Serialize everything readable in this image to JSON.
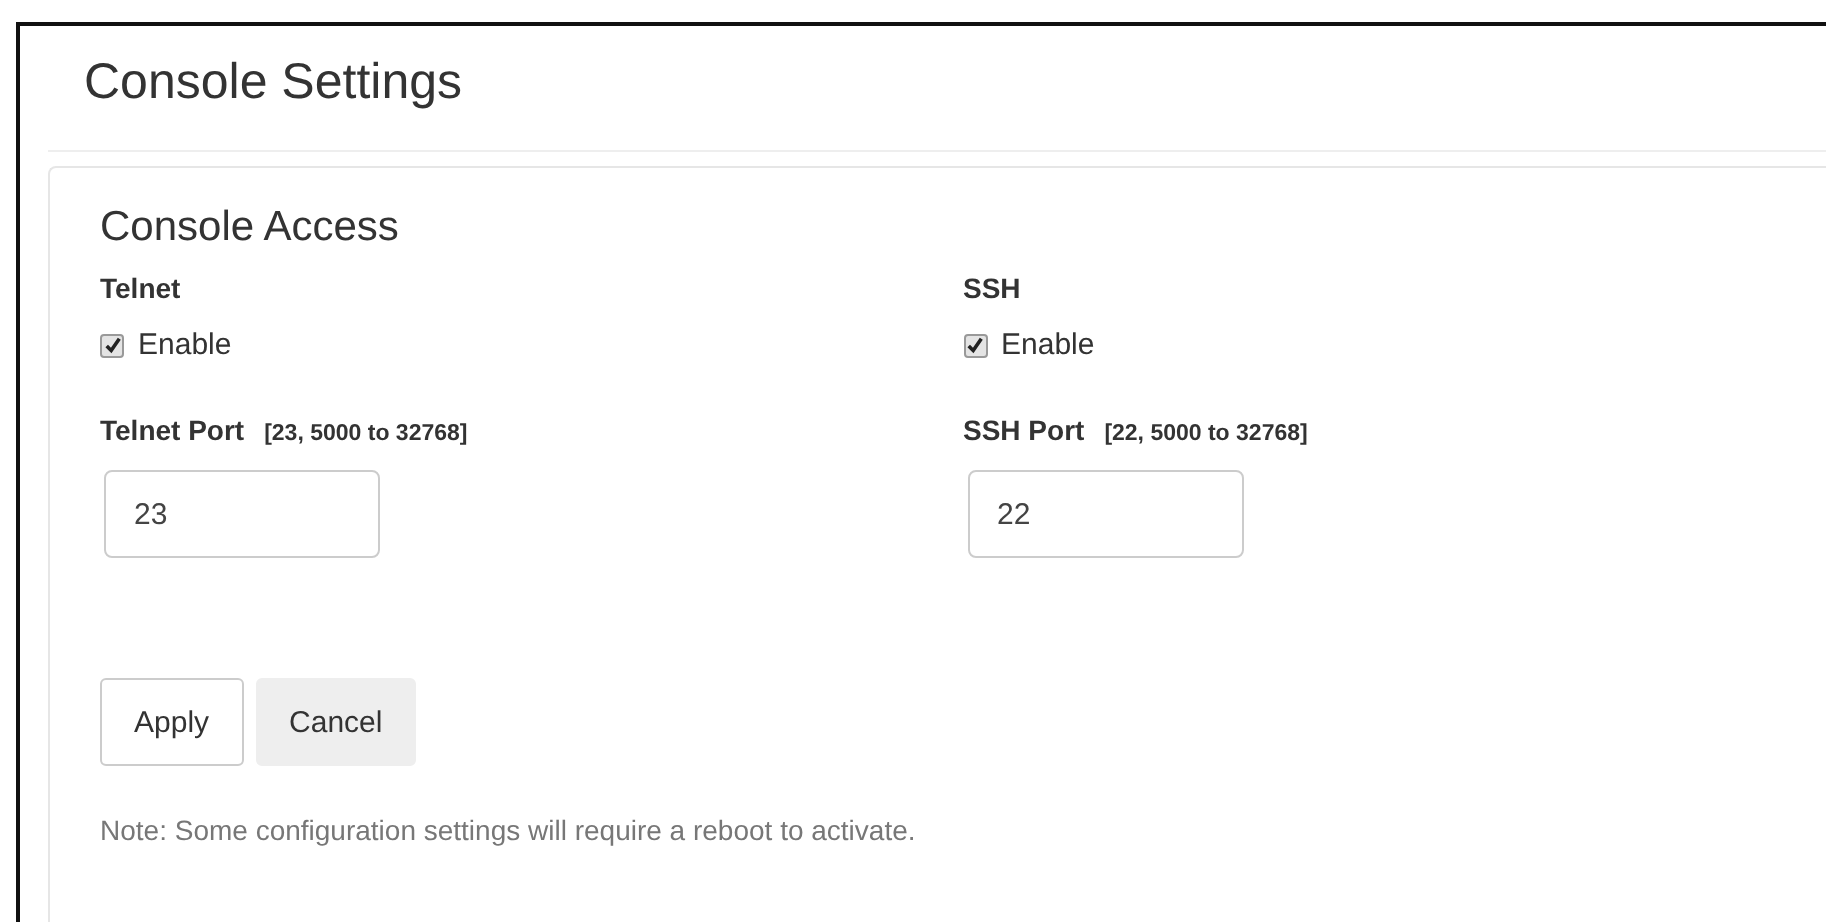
{
  "page_title": "Console Settings",
  "section": {
    "title": "Console Access",
    "groups": [
      {
        "label": "Telnet",
        "enable": {
          "label": "Enable",
          "checked": true
        },
        "port_label": "Telnet Port",
        "port_range": "[23, 5000 to 32768]",
        "port_value": "23"
      },
      {
        "label": "SSH",
        "enable": {
          "label": "Enable",
          "checked": true
        },
        "port_label": "SSH Port",
        "port_range": "[22, 5000 to 32768]",
        "port_value": "22"
      }
    ],
    "buttons": [
      {
        "label": "Apply",
        "kind": "primary"
      },
      {
        "label": "Cancel",
        "kind": "secondary"
      }
    ],
    "note": "Note: Some configuration settings will require a reboot to activate."
  }
}
